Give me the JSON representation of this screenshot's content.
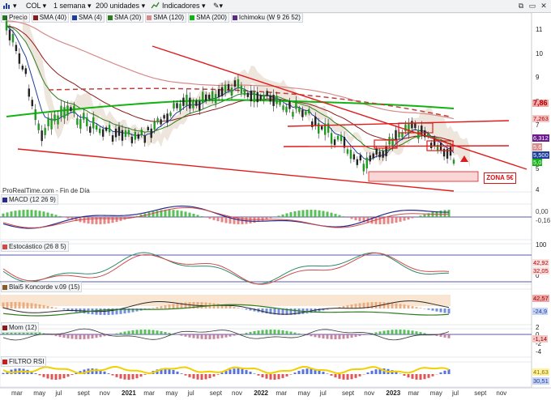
{
  "toolbar": {
    "symbol": "COL",
    "period": "1 semana",
    "units": "200 unidades",
    "indicators": "Indicadores"
  },
  "legend": [
    {
      "label": "Precio",
      "color": "#1f7a1f"
    },
    {
      "label": "SMA (40)",
      "color": "#8b1a1a"
    },
    {
      "label": "SMA (4)",
      "color": "#1e3d9c"
    },
    {
      "label": "SMA (20)",
      "color": "#2e7d1e"
    },
    {
      "label": "SMA (120)",
      "color": "#d88a8a"
    },
    {
      "label": "SMA (200)",
      "color": "#12b312"
    },
    {
      "label": "Ichimoku (W 9 26 52)",
      "color": "#5b2a86"
    }
  ],
  "source_text": "ProRealTime.com - Fin de Día",
  "zona_label": "ZONA 5€",
  "price_axis": [
    "11",
    "10",
    "9",
    "8",
    "7",
    "6",
    "5",
    "4"
  ],
  "price_tags": [
    {
      "label": "7,86",
      "color": "#f1a8a8",
      "text_color": "#b00000"
    },
    {
      "label": "7,263",
      "color": "#f4c6c6",
      "text_color": "#b00000"
    },
    {
      "label": "6,312",
      "color": "#6a1c8c",
      "text_color": "#ffffff"
    },
    {
      "label": "5,6",
      "color": "#d88a8a",
      "text_color": "#ffffff"
    },
    {
      "label": "5,500",
      "color": "#1e3d9c",
      "text_color": "#ffffff"
    },
    {
      "label": "5,0",
      "color": "#12b312",
      "text_color": "#ffffff"
    }
  ],
  "panels": [
    {
      "name": "MACD (12 26 9)",
      "axis": [
        "0,00",
        "-0,16"
      ],
      "tags": [
        "-0,00",
        "-0,16"
      ]
    },
    {
      "name": "Estocástico (26 8 5)",
      "axis": [
        "100",
        "0"
      ],
      "tags": [
        "42,92",
        "32,05"
      ]
    },
    {
      "name": "Blai5 Koncorde v.09 (15)",
      "axis": [
        "42,57",
        "-24,9"
      ],
      "tags": [
        "42,57",
        "-24,9"
      ]
    },
    {
      "name": "Mom (12)",
      "axis": [
        "2",
        "0",
        "-2",
        "-4"
      ],
      "tags": [
        "-1,14"
      ]
    },
    {
      "name": "FILTRO RSI",
      "axis": [
        "41,63",
        "30,51"
      ],
      "tags": [
        "41,63",
        "30,51"
      ]
    }
  ],
  "x_axis": [
    {
      "label": "mar",
      "bold": false
    },
    {
      "label": "may",
      "bold": false
    },
    {
      "label": "jul",
      "bold": false
    },
    {
      "label": "sept",
      "bold": false
    },
    {
      "label": "nov",
      "bold": false
    },
    {
      "label": "2021",
      "bold": true
    },
    {
      "label": "mar",
      "bold": false
    },
    {
      "label": "may",
      "bold": false
    },
    {
      "label": "jul",
      "bold": false
    },
    {
      "label": "sept",
      "bold": false
    },
    {
      "label": "nov",
      "bold": false
    },
    {
      "label": "2022",
      "bold": true
    },
    {
      "label": "mar",
      "bold": false
    },
    {
      "label": "may",
      "bold": false
    },
    {
      "label": "jul",
      "bold": false
    },
    {
      "label": "sept",
      "bold": false
    },
    {
      "label": "nov",
      "bold": false
    },
    {
      "label": "2023",
      "bold": true
    },
    {
      "label": "mar",
      "bold": false
    },
    {
      "label": "may",
      "bold": false
    },
    {
      "label": "jul",
      "bold": false
    },
    {
      "label": "sept",
      "bold": false
    },
    {
      "label": "nov",
      "bold": false
    }
  ],
  "colors": {
    "trendline": "#e01b1b",
    "ichimoku_cloud": "#d9c8b4",
    "sma200": "#12b312",
    "panel_line": "#2a2a8a"
  }
}
